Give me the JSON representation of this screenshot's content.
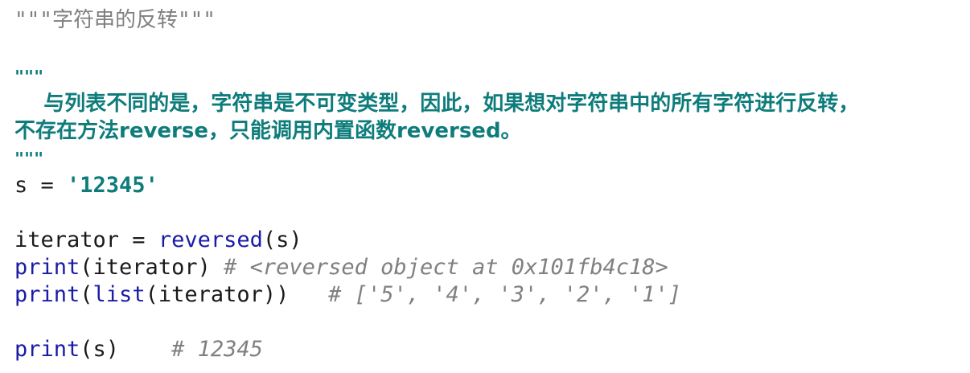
{
  "editor": {
    "line1": {
      "quote_open": "\"\"\"",
      "text": "字符串的反转",
      "quote_close": "\"\"\""
    },
    "doc_open": "\"\"\"",
    "doc_line1": "    与列表不同的是，字符串是不可变类型，因此，如果想对字符串中的所有字符进行反转，",
    "doc_line2": "不存在方法reverse，只能调用内置函数reversed。",
    "doc_close": "\"\"\"",
    "assign": {
      "lhs": "s = ",
      "value": "'12345'"
    },
    "iter_line": {
      "lhs": "iterator = ",
      "func": "reversed",
      "args": "(s)"
    },
    "print1": {
      "func": "print",
      "args": "(iterator)",
      "comment": "# <reversed object at 0x101fb4c18>"
    },
    "print2": {
      "func": "print",
      "open": "(",
      "inner_func": "list",
      "args": "(iterator))",
      "comment": "# ['5', '4', '3', '2', '1']"
    },
    "print3": {
      "func": "print",
      "args": "(s)",
      "comment": "# 12345"
    }
  }
}
